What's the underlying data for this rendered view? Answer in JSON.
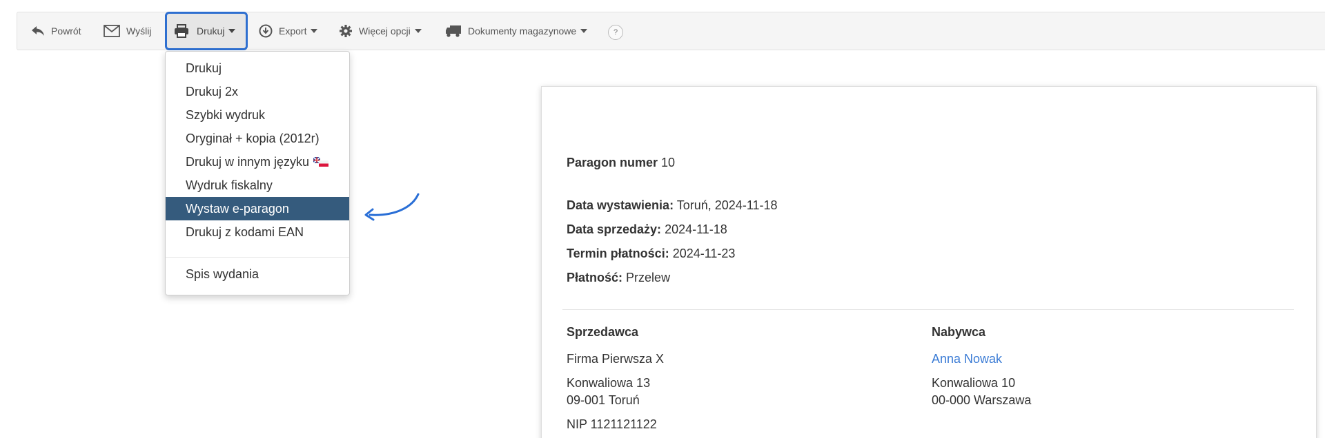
{
  "toolbar": {
    "back_label": "Powrót",
    "send_label": "Wyślij",
    "print_label": "Drukuj",
    "export_label": "Export",
    "more_label": "Więcej opcji",
    "warehouse_label": "Dokumenty magazynowe",
    "help_label": "?"
  },
  "print_menu": {
    "items": [
      "Drukuj",
      "Drukuj 2x",
      "Szybki wydruk",
      "Oryginał + kopia (2012r)",
      "Drukuj w innym języku",
      "Wydruk fiskalny",
      "Wystaw e-paragon",
      "Drukuj z kodami EAN",
      "Spis wydania"
    ],
    "active_item": "Wystaw e-paragon"
  },
  "document": {
    "title_label": "Paragon numer",
    "title_number": "10",
    "issue_date_label": "Data wystawienia:",
    "issue_date_value": "Toruń, 2024-11-18",
    "sale_date_label": "Data sprzedaży:",
    "sale_date_value": "2024-11-18",
    "due_date_label": "Termin płatności:",
    "due_date_value": "2024-11-23",
    "payment_label": "Płatność:",
    "payment_value": "Przelew",
    "seller": {
      "heading": "Sprzedawca",
      "name": "Firma Pierwsza X",
      "street": "Konwaliowa 13",
      "city": "09-001 Toruń",
      "nip": "NIP 1121121122"
    },
    "buyer": {
      "heading": "Nabywca",
      "name": "Anna Nowak",
      "street": "Konwaliowa 10",
      "city": "00-000 Warszawa"
    }
  },
  "colors": {
    "accent_border": "#2e6fd0",
    "menu_active_bg": "#355b7d",
    "link": "#3a7bd5",
    "arrow": "#2a6fd6"
  }
}
